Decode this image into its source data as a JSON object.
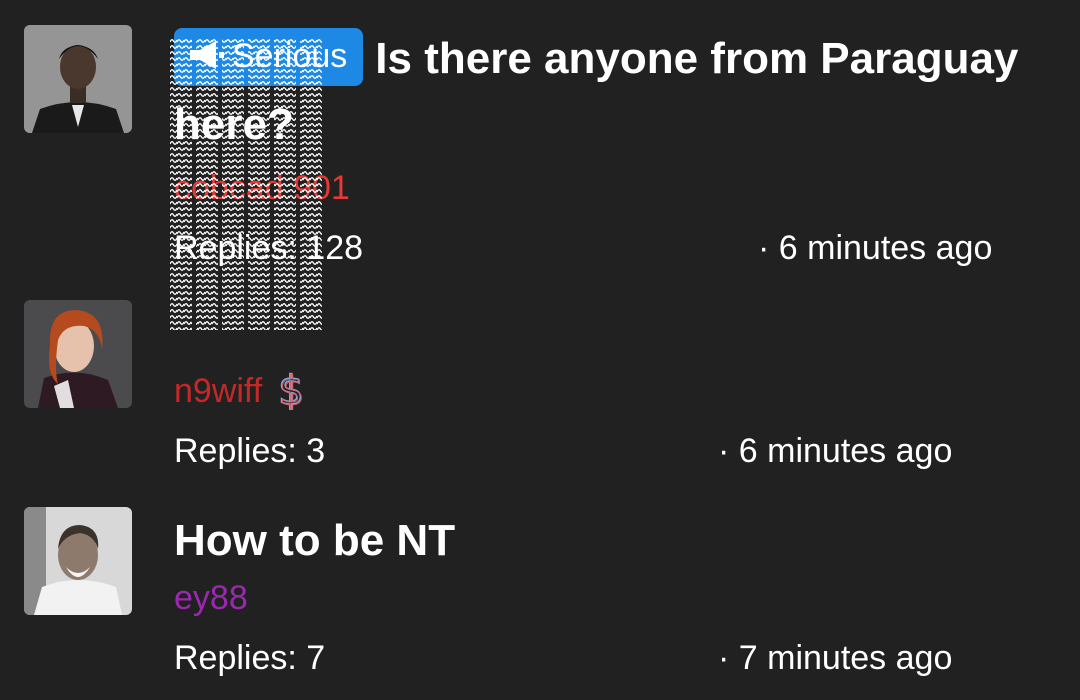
{
  "threads": [
    {
      "badge_label": "Serious",
      "badge_icon": "megaphone-icon",
      "badge_color": "#1e88e5",
      "title": "Is there anyone from Paraguay here?",
      "author": "cobcad 901",
      "author_color": "#e53935",
      "replies": "Replies: 128",
      "time": "· 6 minutes ago"
    },
    {
      "title": "",
      "author": "n9wiff",
      "author_color": "#c62828",
      "author_badge_icon": "dollar-icon",
      "replies": "Replies: 3",
      "time": "· 6 minutes ago"
    },
    {
      "title": "How to be NT",
      "author": "ey88",
      "author_color": "#9c27b0",
      "replies": "Replies: 7",
      "time": "· 7 minutes ago"
    }
  ]
}
